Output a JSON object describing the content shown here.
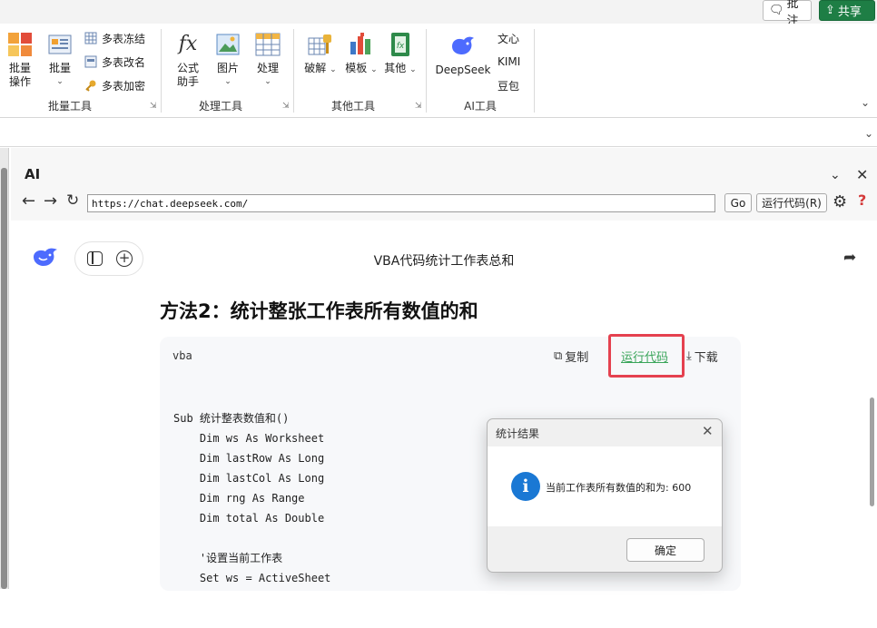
{
  "top": {
    "comment_label": "批注",
    "share_label": "共享"
  },
  "ribbon": {
    "batch_operate": [
      "批量",
      "操作"
    ],
    "batch": "批量",
    "multi_sheet": [
      "多表冻结",
      "多表改名",
      "多表加密"
    ],
    "group1_label": "批量工具",
    "formula_helper": [
      "公式",
      "助手"
    ],
    "picture": "图片",
    "process": "处理",
    "group2_label": "处理工具",
    "crack": "破解",
    "template": "模板",
    "other": "其他",
    "group3_label": "其他工具",
    "deepseek": "DeepSeek",
    "wenxin": "文心",
    "kimi": "KIMI",
    "doubao": "豆包",
    "group4_label": "AI工具"
  },
  "ai_pane": {
    "title": "AI",
    "url": "https://chat.deepseek.com/",
    "go_label": "Go",
    "run_code_label": "运行代码(R)",
    "help_label": "?"
  },
  "chat": {
    "title": "VBA代码统计工作表总和",
    "heading": "方法2：统计整张工作表所有数值的和",
    "code_lang": "vba",
    "copy_label": "复制",
    "run_label": "运行代码",
    "download_label": "下载",
    "code_lines": [
      "Sub 统计整表数值和()",
      "    Dim ws As Worksheet",
      "    Dim lastRow As Long",
      "    Dim lastCol As Long",
      "    Dim rng As Range",
      "    Dim total As Double",
      "",
      "    '设置当前工作表",
      "    Set ws = ActiveSheet"
    ]
  },
  "dialog": {
    "title": "统计结果",
    "message": "当前工作表所有数值的和为: 600",
    "ok_label": "确定"
  }
}
